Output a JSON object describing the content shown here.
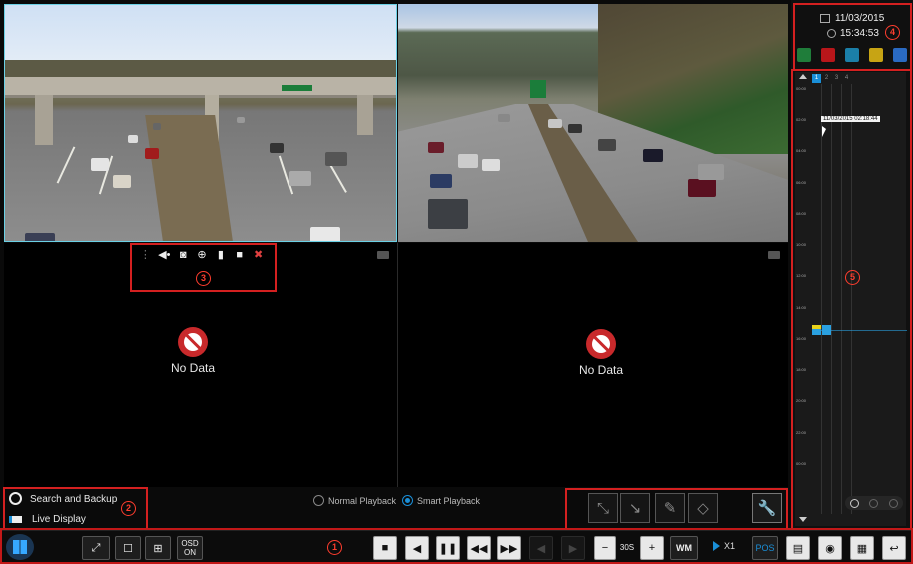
{
  "datetime": {
    "date": "11/03/2015",
    "time": "15:34:53"
  },
  "markers": {
    "m1": "1",
    "m2": "2",
    "m3": "3",
    "m4": "4",
    "m5": "5"
  },
  "timeline": {
    "channels": [
      "1",
      "2",
      "3",
      "4"
    ],
    "cursor_label": "11/03/2015 02:18:44",
    "ticks": [
      "00:00",
      "02:00",
      "04:00",
      "06:00",
      "08:00",
      "10:00",
      "12:00",
      "14:00",
      "16:00",
      "18:00",
      "20:00",
      "22:00",
      "00:00"
    ]
  },
  "cameras": [
    {
      "id": 1,
      "status": "",
      "has_video": true
    },
    {
      "id": 2,
      "status": "",
      "has_video": true
    },
    {
      "id": 3,
      "status": "No Data",
      "has_video": false
    },
    {
      "id": 4,
      "status": "No Data",
      "has_video": false
    }
  ],
  "left_menu": {
    "search_backup": "Search and Backup",
    "live_display": "Live Display"
  },
  "playback_mode": {
    "normal": "Normal Playback",
    "smart": "Smart Playback",
    "selected": "smart"
  },
  "toolbar": {
    "osd_label_1": "OSD",
    "osd_label_2": "ON",
    "step_label": "30S",
    "speed_label": "X1",
    "pos_label": "POS",
    "wm_label": "WM"
  },
  "colors": {
    "accent": "#1a8fd8",
    "marker": "#ff3d2e",
    "record_yellow": "#e8d21a",
    "record_blue": "#2aa0e0"
  }
}
